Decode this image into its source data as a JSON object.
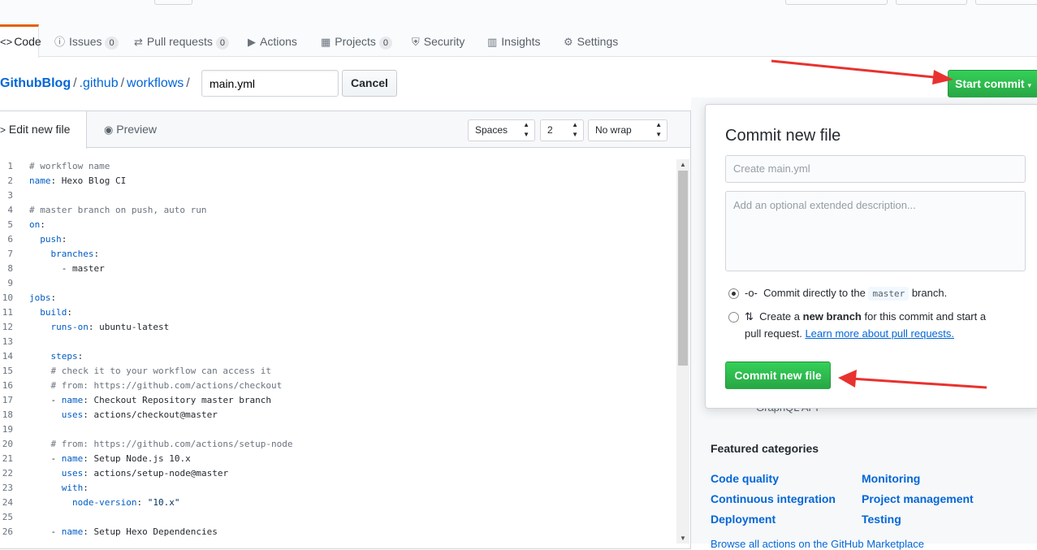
{
  "tabs": [
    {
      "icon": "<>",
      "label": "Code",
      "count": ""
    },
    {
      "icon": "ⓘ",
      "label": "Issues",
      "count": "0"
    },
    {
      "icon": "⇄",
      "label": "Pull requests",
      "count": "0"
    },
    {
      "icon": "▶",
      "label": "Actions",
      "count": ""
    },
    {
      "icon": "▦",
      "label": "Projects",
      "count": "0"
    },
    {
      "icon": "⛨",
      "label": "Security",
      "count": ""
    },
    {
      "icon": "▥",
      "label": "Insights",
      "count": ""
    },
    {
      "icon": "⚙",
      "label": "Settings",
      "count": ""
    }
  ],
  "breadcrumb": {
    "repo": "GithubBlog",
    "sep": "/",
    "dir1": ".github",
    "dir2": "workflows"
  },
  "filename": {
    "value": "main.yml"
  },
  "buttons": {
    "cancel": "Cancel",
    "start_commit": "Start commit",
    "commit_new_file": "Commit new file"
  },
  "editor": {
    "tab_edit": "Edit new file",
    "tab_preview": "Preview",
    "indent_mode": "Spaces",
    "indent_size": "2",
    "wrap_mode": "No wrap",
    "lines": [
      "# workflow name",
      "name: Hexo Blog CI",
      "",
      "# master branch on push, auto run",
      "on:",
      "  push:",
      "    branches:",
      "      - master",
      "",
      "jobs:",
      "  build:",
      "    runs-on: ubuntu-latest",
      "",
      "    steps:",
      "    # check it to your workflow can access it",
      "    # from: https://github.com/actions/checkout",
      "    - name: Checkout Repository master branch",
      "      uses: actions/checkout@master",
      "",
      "    # from: https://github.com/actions/setup-node",
      "    - name: Setup Node.js 10.x",
      "      uses: actions/setup-node@master",
      "      with:",
      "        node-version: \"10.x\"",
      "",
      "    - name: Setup Hexo Dependencies"
    ]
  },
  "commit_panel": {
    "title": "Commit new file",
    "summary_placeholder": "Create main.yml",
    "description_placeholder": "Add an optional extended description...",
    "option1_prefix": "Commit directly to the",
    "option1_branch": "master",
    "option1_suffix": "branch.",
    "option2_prefix": "Create a",
    "option2_bold": "new branch",
    "option2_suffix": "for this commit and start a",
    "option2_line2": "pull request.",
    "option2_link": "Learn more about pull requests."
  },
  "sidebar": {
    "partial_text": "GraphQL API",
    "featured_title": "Featured categories",
    "categories": [
      "Code quality",
      "Monitoring",
      "Continuous integration",
      "Project management",
      "Deployment",
      "Testing"
    ],
    "partial_link": "Browse all actions on the GitHub Marketplace"
  },
  "colors": {
    "accent": "#28a745",
    "link": "#0366d6",
    "annotation_arrow": "#e8322f"
  }
}
